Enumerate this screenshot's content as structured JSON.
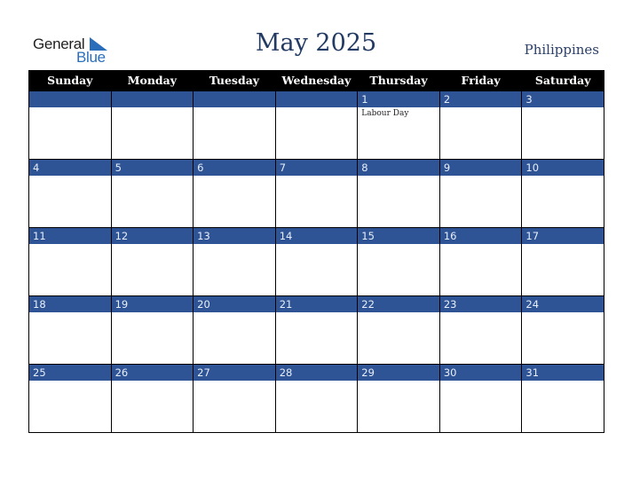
{
  "logo": {
    "line1": "General",
    "line2": "Blue",
    "accent": "#2a6ebb"
  },
  "header": {
    "title": "May 2025",
    "country": "Philippines"
  },
  "colors": {
    "header_bg": "#000000",
    "band_bg": "#2f5496",
    "title": "#233a63"
  },
  "weekdays": [
    "Sunday",
    "Monday",
    "Tuesday",
    "Wednesday",
    "Thursday",
    "Friday",
    "Saturday"
  ],
  "weeks": [
    [
      {
        "day": ""
      },
      {
        "day": ""
      },
      {
        "day": ""
      },
      {
        "day": ""
      },
      {
        "day": "1",
        "holiday": "Labour Day"
      },
      {
        "day": "2"
      },
      {
        "day": "3"
      }
    ],
    [
      {
        "day": "4"
      },
      {
        "day": "5"
      },
      {
        "day": "6"
      },
      {
        "day": "7"
      },
      {
        "day": "8"
      },
      {
        "day": "9"
      },
      {
        "day": "10"
      }
    ],
    [
      {
        "day": "11"
      },
      {
        "day": "12"
      },
      {
        "day": "13"
      },
      {
        "day": "14"
      },
      {
        "day": "15"
      },
      {
        "day": "16"
      },
      {
        "day": "17"
      }
    ],
    [
      {
        "day": "18"
      },
      {
        "day": "19"
      },
      {
        "day": "20"
      },
      {
        "day": "21"
      },
      {
        "day": "22"
      },
      {
        "day": "23"
      },
      {
        "day": "24"
      }
    ],
    [
      {
        "day": "25"
      },
      {
        "day": "26"
      },
      {
        "day": "27"
      },
      {
        "day": "28"
      },
      {
        "day": "29"
      },
      {
        "day": "30"
      },
      {
        "day": "31"
      }
    ]
  ]
}
